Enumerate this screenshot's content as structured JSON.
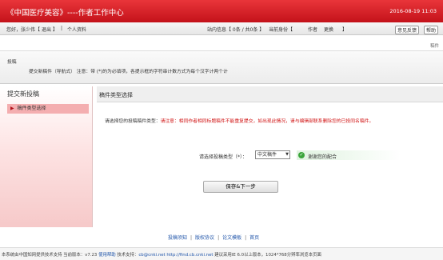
{
  "header": {
    "title": "《中国医疗美容》----作者工作中心",
    "datetime": "2016-08-19 11:03"
  },
  "userbar": {
    "greeting": "您好，张少伟【",
    "logout": "退出",
    "close_bracket": "】",
    "sep": "|",
    "profile": "个人资料",
    "site_info": "站内信息【 0条 / 共0条 】",
    "identity_label": "当前身份【",
    "identity_value": "作者",
    "switch": "更换",
    "identity_close": "】",
    "feedback": "意见反馈",
    "help": "帮助"
  },
  "topright_label": "稿件",
  "notice": {
    "title": "投稿",
    "text": "提交新稿件（导航式） 注意：带 (*)的为必填项，各提示框的字符串计数方式为每个汉字计两个计"
  },
  "sidebar": {
    "heading": "提交新投稿",
    "item_arrow": "▶",
    "item_label": "稿件类型选择"
  },
  "main": {
    "heading": "稿件类型选择",
    "prompt": "请选择您的投稿稿件类型：",
    "warning": "请注意：相同作者相同标题稿件不能重复提交，如出现此情况，请与编辑部联系删除您的已投同名稿件。",
    "select_label": "请选择投稿类型（*）：",
    "select_value": "中文稿件",
    "select_caret": "▼",
    "ok_icon": "✓",
    "ok_text": "谢谢您的配合",
    "save_button": "保存&下一步"
  },
  "footer": {
    "links": [
      "投稿须知",
      "版权协议",
      "论文模板",
      "首页"
    ],
    "sep": "|",
    "text_prefix": "本系统由中国知网提供技术支持 当前版本：v7.23",
    "help_link": "使用帮助",
    "support_label": "技术支持：",
    "email": "cb@cnki.net",
    "url": "http://find.cb.cnki.net",
    "text_suffix": "建议采用IE 6.0以上版本，1024*768分辨率浏览本页面"
  }
}
